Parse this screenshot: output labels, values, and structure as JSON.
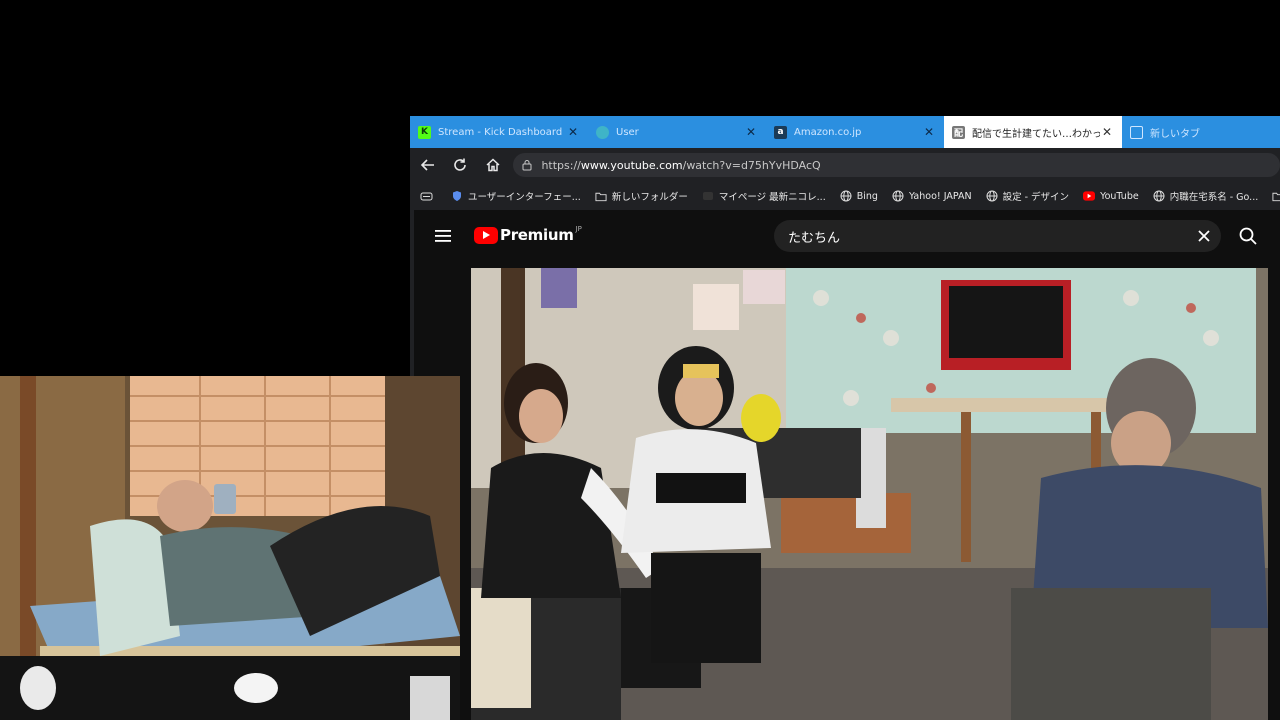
{
  "browser": {
    "tabs": [
      {
        "title": "Stream - Kick Dashboard",
        "icon": "kick-icon",
        "active": false
      },
      {
        "title": "User",
        "icon": "user-icon",
        "active": false
      },
      {
        "title": "Amazon.co.jp",
        "icon": "amazon-icon",
        "active": false
      },
      {
        "title": "配信で生計建てたい…わかってん",
        "icon": "page-icon",
        "active": true
      },
      {
        "title": "新しいタブ",
        "icon": "new-tab-icon",
        "active": false
      }
    ],
    "address": {
      "prefix": "https://",
      "host": "www.youtube.com",
      "path": "/watch?v=d75hYvHDAcQ"
    },
    "bookmarks": [
      {
        "label": "ユーザーインターフェー...",
        "icon": "shield-icon"
      },
      {
        "label": "新しいフォルダー",
        "icon": "folder-icon"
      },
      {
        "label": "マイページ 最新ニコレ...",
        "icon": "niconico-icon"
      },
      {
        "label": "Bing",
        "icon": "globe-icon"
      },
      {
        "label": "Yahoo! JAPAN",
        "icon": "globe-icon"
      },
      {
        "label": "設定 - デザイン",
        "icon": "globe-icon"
      },
      {
        "label": "YouTube",
        "icon": "youtube-icon"
      },
      {
        "label": "内職在宅系名 - Go...",
        "icon": "globe-icon"
      }
    ]
  },
  "youtube": {
    "logo_text": "Premium",
    "logo_region": "JP",
    "search_query": "たむちん"
  },
  "colors": {
    "tabbar": "#2b8fe0",
    "youtube_red": "#ff0000",
    "yt_background": "#0f0f0f"
  }
}
